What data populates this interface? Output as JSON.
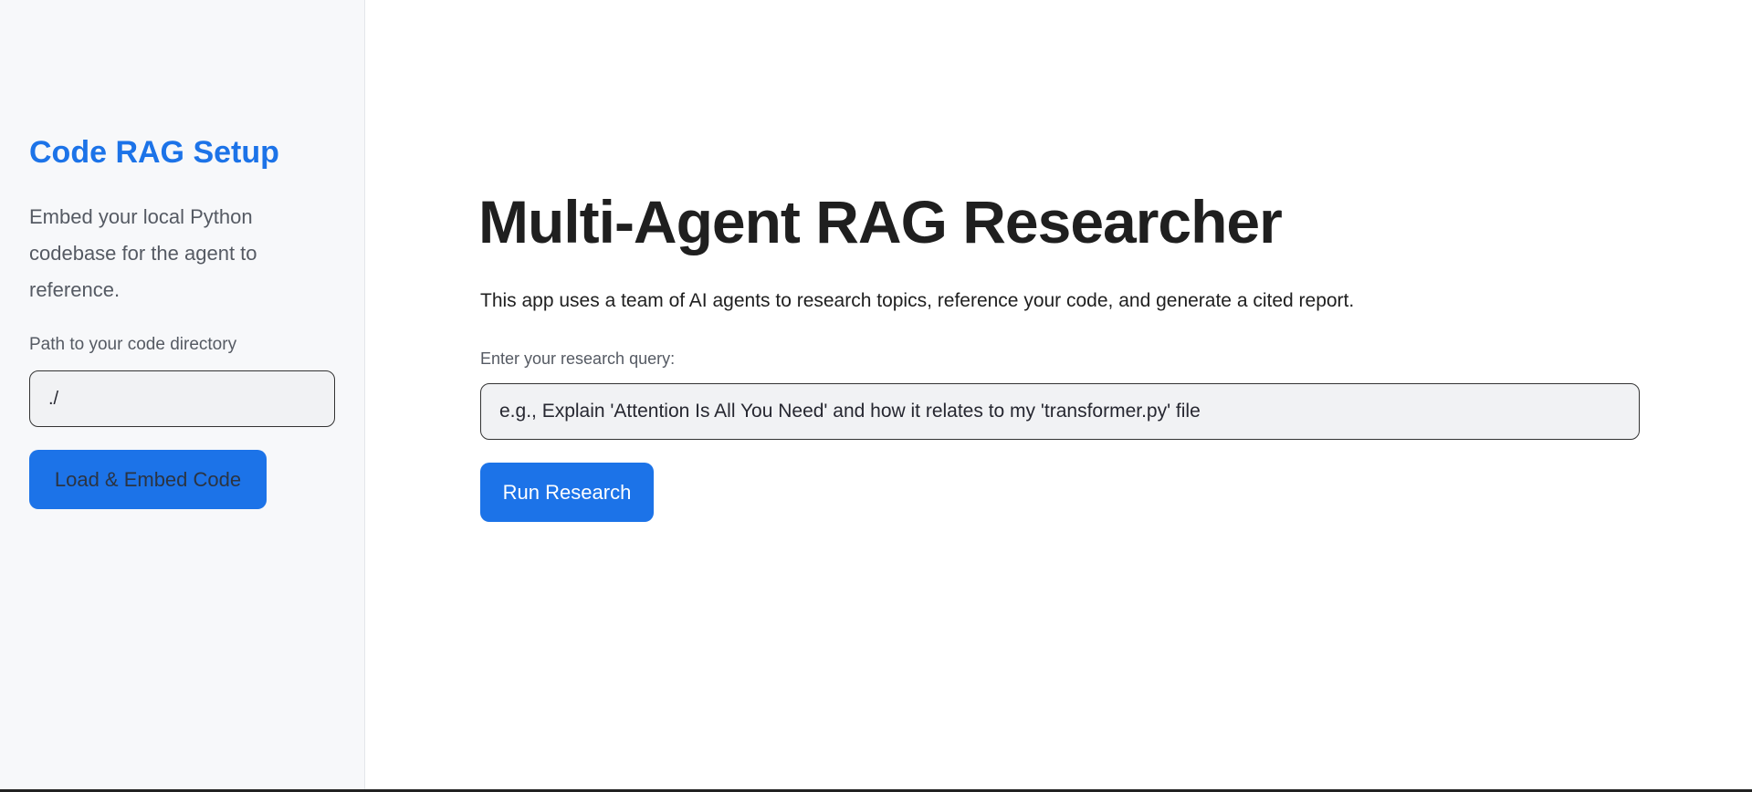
{
  "sidebar": {
    "title": "Code RAG Setup",
    "description": "Embed your local Python codebase for the agent to reference.",
    "path_label": "Path to your code directory",
    "path_value": "./",
    "load_button": "Load & Embed Code"
  },
  "main": {
    "title": "Multi-Agent RAG Researcher",
    "subtitle": "This app uses a team of AI agents to research topics, reference your code, and generate a cited report.",
    "query_label": "Enter your research query:",
    "query_placeholder": "e.g., Explain 'Attention Is All You Need' and how it relates to my 'transformer.py' file",
    "run_button": "Run Research"
  },
  "colors": {
    "accent": "#1c73e8",
    "sidebar_bg": "#f7f8fa"
  }
}
